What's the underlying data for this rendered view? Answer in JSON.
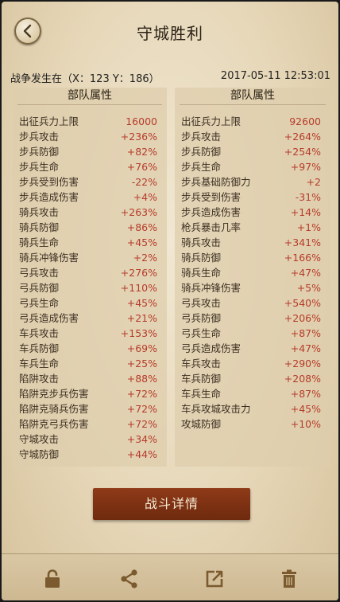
{
  "header": {
    "title": "守城胜利"
  },
  "battle_info": {
    "location_text": "战争发生在（X：123 Y：186）",
    "datetime": "2017-05-11  12:53:01"
  },
  "left_panel": {
    "title": "部队属性",
    "rows": [
      {
        "label": "出征兵力上限",
        "value": "16000"
      },
      {
        "label": "步兵攻击",
        "value": "+236%"
      },
      {
        "label": "步兵防御",
        "value": "+82%"
      },
      {
        "label": "步兵生命",
        "value": "+76%"
      },
      {
        "label": "步兵受到伤害",
        "value": "-22%"
      },
      {
        "label": "步兵造成伤害",
        "value": "+4%"
      },
      {
        "label": "骑兵攻击",
        "value": "+263%"
      },
      {
        "label": "骑兵防御",
        "value": "+86%"
      },
      {
        "label": "骑兵生命",
        "value": "+45%"
      },
      {
        "label": "骑兵冲锋伤害",
        "value": "+2%"
      },
      {
        "label": "弓兵攻击",
        "value": "+276%"
      },
      {
        "label": "弓兵防御",
        "value": "+110%"
      },
      {
        "label": "弓兵生命",
        "value": "+45%"
      },
      {
        "label": "弓兵造成伤害",
        "value": "+21%"
      },
      {
        "label": "车兵攻击",
        "value": "+153%"
      },
      {
        "label": "车兵防御",
        "value": "+69%"
      },
      {
        "label": "车兵生命",
        "value": "+25%"
      },
      {
        "label": "陷阱攻击",
        "value": "+88%"
      },
      {
        "label": "陷阱克步兵伤害",
        "value": "+72%"
      },
      {
        "label": "陷阱克骑兵伤害",
        "value": "+72%"
      },
      {
        "label": "陷阱克弓兵伤害",
        "value": "+72%"
      },
      {
        "label": "守城攻击",
        "value": "+34%"
      },
      {
        "label": "守城防御",
        "value": "+44%"
      }
    ]
  },
  "right_panel": {
    "title": "部队属性",
    "rows": [
      {
        "label": "出征兵力上限",
        "value": "92600"
      },
      {
        "label": "步兵攻击",
        "value": "+264%"
      },
      {
        "label": "步兵防御",
        "value": "+254%"
      },
      {
        "label": "步兵生命",
        "value": "+97%"
      },
      {
        "label": "步兵基础防御力",
        "value": "+2"
      },
      {
        "label": "步兵受到伤害",
        "value": "-31%"
      },
      {
        "label": "步兵造成伤害",
        "value": "+14%"
      },
      {
        "label": "枪兵暴击几率",
        "value": "+1%"
      },
      {
        "label": "骑兵攻击",
        "value": "+341%"
      },
      {
        "label": "骑兵防御",
        "value": "+166%"
      },
      {
        "label": "骑兵生命",
        "value": "+47%"
      },
      {
        "label": "骑兵冲锋伤害",
        "value": "+5%"
      },
      {
        "label": "弓兵攻击",
        "value": "+540%"
      },
      {
        "label": "弓兵防御",
        "value": "+206%"
      },
      {
        "label": "弓兵生命",
        "value": "+87%"
      },
      {
        "label": "弓兵造成伤害",
        "value": "+47%"
      },
      {
        "label": "车兵攻击",
        "value": "+290%"
      },
      {
        "label": "车兵防御",
        "value": "+208%"
      },
      {
        "label": "车兵生命",
        "value": "+87%"
      },
      {
        "label": "车兵攻城攻击力",
        "value": "+45%"
      },
      {
        "label": "攻城防御",
        "value": "+10%"
      }
    ]
  },
  "detail_button": {
    "label": "战斗详情"
  },
  "toolbar": {
    "icons": [
      "lock-icon",
      "share-icon",
      "export-icon",
      "trash-icon"
    ]
  },
  "colors": {
    "value_red": "#b63b2a",
    "button_brown": "#7a2f12",
    "parchment": "#e6d7b8"
  }
}
